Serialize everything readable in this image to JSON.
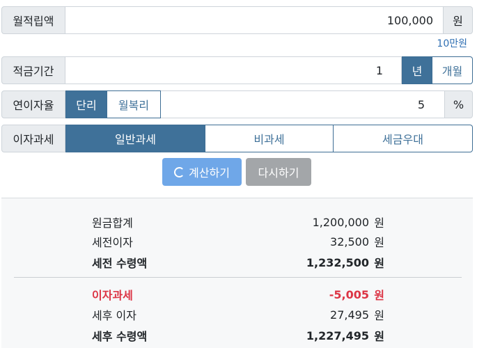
{
  "monthly_deposit": {
    "label": "월적립액",
    "value": "100,000",
    "unit": "원",
    "hint": "10만원"
  },
  "period": {
    "label": "적금기간",
    "value": "1",
    "options": [
      "년",
      "개월"
    ],
    "selected": "년"
  },
  "interest_rate": {
    "label": "연이자율",
    "method_options": [
      "단리",
      "월복리"
    ],
    "selected_method": "단리",
    "value": "5",
    "unit": "%"
  },
  "tax": {
    "label": "이자과세",
    "options": [
      "일반과세",
      "비과세",
      "세금우대"
    ],
    "selected": "일반과세"
  },
  "actions": {
    "calculate": "계산하기",
    "reset": "다시하기"
  },
  "results": {
    "principal": {
      "label": "원금합계",
      "value": "1,200,000",
      "unit": "원"
    },
    "pretax_interest": {
      "label": "세전이자",
      "value": "32,500",
      "unit": "원"
    },
    "pretax_total": {
      "label": "세전 수령액",
      "value": "1,232,500",
      "unit": "원"
    },
    "interest_tax": {
      "label": "이자과세",
      "value": "-5,005",
      "unit": "원"
    },
    "aftertax_interest": {
      "label": "세후 이자",
      "value": "27,495",
      "unit": "원"
    },
    "aftertax_total": {
      "label": "세후 수령액",
      "value": "1,227,495",
      "unit": "원"
    }
  },
  "colors": {
    "primary": "#3f7199",
    "calculate_button": "#6fa7e8",
    "reset_button": "#a3a6a9",
    "tax_red": "#dc3545",
    "hint_blue": "#2f6fb3"
  }
}
